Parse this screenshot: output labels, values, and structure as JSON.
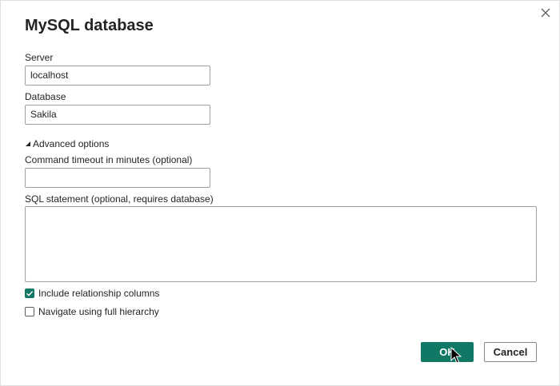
{
  "dialog": {
    "title": "MySQL database",
    "close_icon": "close-icon"
  },
  "form": {
    "server_label": "Server",
    "server_value": "localhost",
    "database_label": "Database",
    "database_value": "Sakila",
    "advanced_label": "Advanced options",
    "advanced_expanded": true,
    "timeout_label": "Command timeout in minutes (optional)",
    "timeout_value": "",
    "sql_label": "SQL statement (optional, requires database)",
    "sql_value": ""
  },
  "options": {
    "include_relationship_label": "Include relationship columns",
    "include_relationship_checked": true,
    "navigate_hierarchy_label": "Navigate using full hierarchy",
    "navigate_hierarchy_checked": false
  },
  "buttons": {
    "ok_label": "OK",
    "cancel_label": "Cancel"
  },
  "colors": {
    "accent": "#117865",
    "border": "#a19f9d",
    "text": "#252423"
  }
}
